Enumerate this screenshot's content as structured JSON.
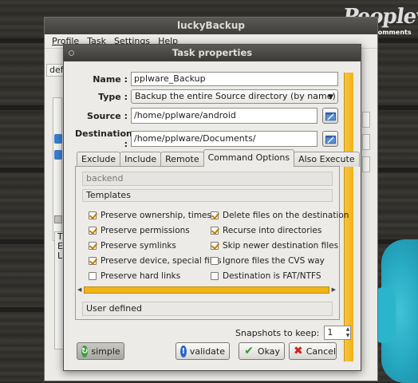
{
  "desktop": {
    "logo_text": "Peopleware",
    "logo_subtext": "No comments"
  },
  "main_window": {
    "title": "luckyBackup",
    "menu": [
      "Profile",
      "Task",
      "Settings",
      "Help"
    ],
    "fragment_default": "defa",
    "fragment_lines": [
      "T",
      "E",
      "L"
    ]
  },
  "dialog": {
    "title": "Task properties",
    "name_label": "Name :",
    "name_value": "pplware_Backup",
    "type_label": "Type :",
    "type_value": "Backup the entire Source directory (by name)",
    "source_label": "Source :",
    "source_value": "/home/pplware/android",
    "destination_label": "Destination :",
    "destination_value": "/home/pplware/Documents/",
    "tabs": [
      "Exclude",
      "Include",
      "Remote",
      "Command Options",
      "Also Execute"
    ],
    "active_tab": "Command Options",
    "backend_placeholder": "backend",
    "templates_label": "Templates",
    "options_left": [
      {
        "label": "Preserve ownership, times",
        "checked": true
      },
      {
        "label": "Preserve permissions",
        "checked": true
      },
      {
        "label": "Preserve symlinks",
        "checked": true
      },
      {
        "label": "Preserve device, special files",
        "checked": true
      },
      {
        "label": "Preserve hard links",
        "checked": false
      }
    ],
    "options_right": [
      {
        "label": "Delete files on the destination",
        "checked": true
      },
      {
        "label": "Recurse into directories",
        "checked": true
      },
      {
        "label": "Skip newer destination files",
        "checked": true
      },
      {
        "label": "Ignore files the CVS way",
        "checked": false
      },
      {
        "label": "Destination is FAT/NTFS",
        "checked": false
      }
    ],
    "user_defined_label": "User defined",
    "snapshots_label": "Snapshots to keep:",
    "snapshots_value": "1",
    "buttons": {
      "simple": "simple",
      "validate": "validate",
      "okay": "Okay",
      "cancel": "Cancel"
    }
  },
  "colors": {
    "accent": "#f2b21a",
    "titlebar": "#3f3e3a",
    "check": "#c17d00"
  }
}
